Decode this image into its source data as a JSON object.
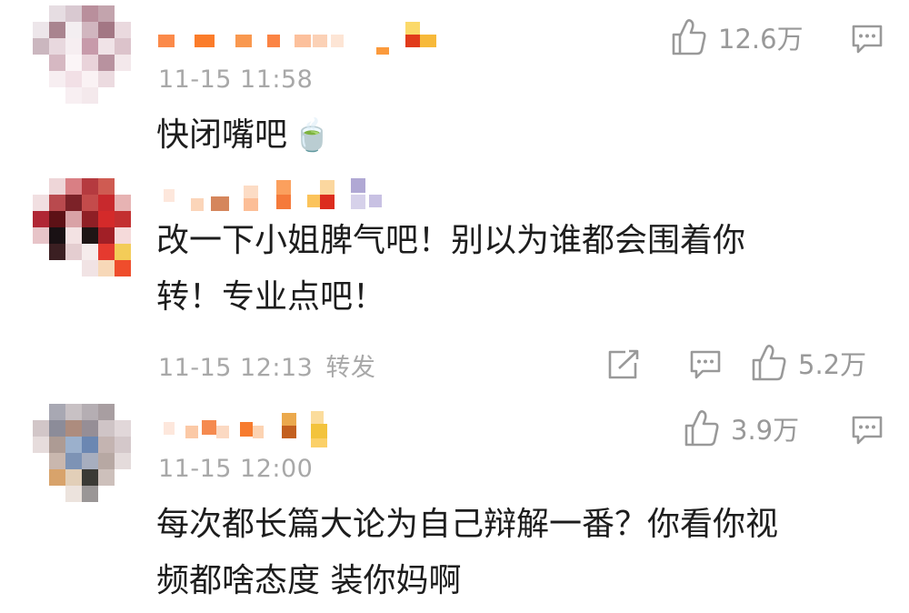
{
  "comments": [
    {
      "time": "11-15 11:58",
      "text_lines": [
        "快闭嘴吧"
      ],
      "emoji": "🍵",
      "like_count": "12.6万",
      "icons": [
        "like-icon",
        "comment-icon"
      ]
    },
    {
      "time": "11-15 12:13",
      "repost_label": "转发",
      "text_lines": [
        "改一下小姐脾气吧！别以为谁都会围着你",
        "转！专业点吧！"
      ],
      "like_count": "5.2万",
      "icons": [
        "share-icon",
        "comment-icon",
        "like-icon"
      ]
    },
    {
      "time": "11-15 12:00",
      "text_lines": [
        "每次都长篇大论为自己辩解一番？你看你视",
        "频都啥态度 装你妈啊"
      ],
      "like_count": "3.9万",
      "icons": [
        "like-icon",
        "comment-icon"
      ]
    }
  ],
  "colors": {
    "meta_gray": "#a8a8a8",
    "icon_gray": "#999999",
    "text": "#1d1d1d",
    "background": "#ffffff"
  }
}
